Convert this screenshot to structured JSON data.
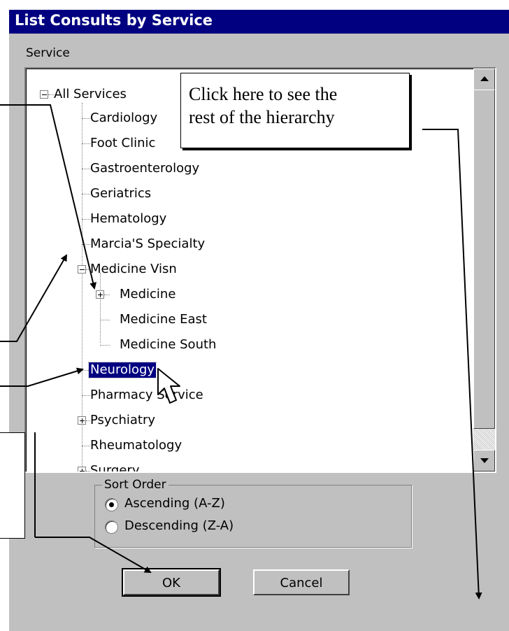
{
  "dialog": {
    "title": "List Consults by Service",
    "service_label": "Service",
    "tree": [
      {
        "label": "All Services",
        "expander": "minus"
      },
      {
        "label": "Cardiology"
      },
      {
        "label": "Foot Clinic"
      },
      {
        "label": "Gastroenterology"
      },
      {
        "label": "Geriatrics"
      },
      {
        "label": "Hematology"
      },
      {
        "label": "Marcia'S Specialty"
      },
      {
        "label": "Medicine Visn",
        "expander": "minus"
      },
      {
        "label": "Medicine",
        "expander": "plus"
      },
      {
        "label": "Medicine East"
      },
      {
        "label": "Medicine South"
      },
      {
        "label": "Neurology",
        "selected": true
      },
      {
        "label": "Pharmacy Service"
      },
      {
        "label": "Psychiatry",
        "expander": "plus"
      },
      {
        "label": "Rheumatology"
      },
      {
        "label": "Surgery",
        "expander": "plus"
      }
    ],
    "sort_order": {
      "label": "Sort Order",
      "options": [
        {
          "label": "Ascending (A-Z)",
          "checked": true
        },
        {
          "label": "Descending (Z-A)",
          "checked": false
        }
      ]
    },
    "ok_label": "OK",
    "cancel_label": "Cancel"
  },
  "callout": {
    "line1": "Click here to see the",
    "line2": "rest of the hierarchy"
  },
  "colors": {
    "titlebar": "#000080",
    "dialog_bg": "#c0c0c0",
    "selection": "#000080"
  }
}
